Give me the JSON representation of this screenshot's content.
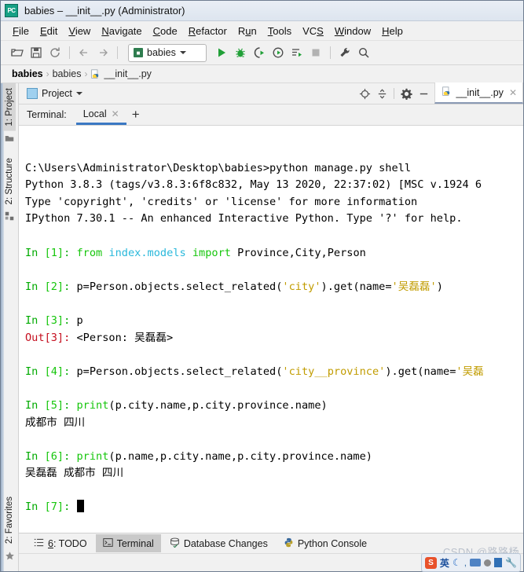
{
  "window": {
    "app_icon": "pycharm-icon",
    "title": "babies – __init__.py (Administrator)"
  },
  "menubar": {
    "items": [
      {
        "label": "File",
        "mnemonic": "F"
      },
      {
        "label": "Edit",
        "mnemonic": "E"
      },
      {
        "label": "View",
        "mnemonic": "V"
      },
      {
        "label": "Navigate",
        "mnemonic": "N"
      },
      {
        "label": "Code",
        "mnemonic": "C"
      },
      {
        "label": "Refactor",
        "mnemonic": "R"
      },
      {
        "label": "Run",
        "mnemonic": "u"
      },
      {
        "label": "Tools",
        "mnemonic": "T"
      },
      {
        "label": "VCS",
        "mnemonic": "S"
      },
      {
        "label": "Window",
        "mnemonic": "W"
      },
      {
        "label": "Help",
        "mnemonic": "H"
      }
    ]
  },
  "toolbar": {
    "icons": [
      "open-folder-icon",
      "save-all-icon",
      "sync-refresh-icon",
      "back-arrow-icon",
      "forward-arrow-icon"
    ],
    "run_config": {
      "name": "babies",
      "icon": "run-config-icon",
      "dropdown": "chevron-down-icon"
    },
    "run_icons": [
      "run-icon",
      "debug-icon",
      "run-with-coverage-icon",
      "profile-icon",
      "run-todo-icon",
      "stop-icon"
    ],
    "right_icons": [
      "settings-wrench-icon",
      "search-icon"
    ]
  },
  "breadcrumb": {
    "items": [
      "babies",
      "babies",
      "__init__.py"
    ],
    "separator": "›",
    "file_icon": "python-file-icon"
  },
  "leftbar": {
    "tabs": [
      {
        "label": "1: Project",
        "icon": "project-folder-icon",
        "selected": true
      },
      {
        "label": "2: Structure",
        "icon": "structure-icon",
        "selected": false
      },
      {
        "label": "2: Favorites",
        "icon": "star-icon",
        "selected": false
      }
    ]
  },
  "toolwindow": {
    "title": "Project",
    "title_icon": "project-window-icon",
    "dropdown": "chevron-down-icon",
    "actions": [
      "locate-target-icon",
      "collapse-all-icon",
      "settings-gear-icon",
      "hide-window-icon"
    ],
    "editor_tab": {
      "label": "__init__.py",
      "icon": "python-file-icon",
      "close": "close-icon"
    }
  },
  "terminal_tabs": {
    "label": "Terminal:",
    "tabs": [
      {
        "label": "Local",
        "close": "close-icon",
        "selected": true
      }
    ],
    "add_button": "+"
  },
  "terminal": {
    "lines": [
      {
        "type": "blank"
      },
      {
        "segments": [
          {
            "text": "C:\\Users\\Administrator\\Desktop\\babies>python manage.py shell",
            "color": "default"
          }
        ]
      },
      {
        "segments": [
          {
            "text": "Python 3.8.3 (tags/v3.8.3:6f8c832, May 13 2020, 22:37:02) [MSC v.1924 6",
            "color": "default"
          }
        ]
      },
      {
        "segments": [
          {
            "text": "Type 'copyright', 'credits' or 'license' for more information",
            "color": "default"
          }
        ]
      },
      {
        "segments": [
          {
            "text": "IPython 7.30.1 -- An enhanced Interactive Python. Type '?' for help.",
            "color": "default"
          }
        ]
      },
      {
        "type": "blank"
      },
      {
        "segments": [
          {
            "text": "In ",
            "color": "green"
          },
          {
            "text": "[1]",
            "color": "brightgreen"
          },
          {
            "text": ": ",
            "color": "green"
          },
          {
            "text": "from ",
            "color": "brightgreen"
          },
          {
            "text": "index.models ",
            "color": "cyan"
          },
          {
            "text": "import ",
            "color": "brightgreen"
          },
          {
            "text": "Province,City,Person",
            "color": "default"
          }
        ]
      },
      {
        "type": "blank"
      },
      {
        "segments": [
          {
            "text": "In ",
            "color": "green"
          },
          {
            "text": "[2]",
            "color": "brightgreen"
          },
          {
            "text": ": ",
            "color": "green"
          },
          {
            "text": "p=Person.objects.select_related(",
            "color": "default"
          },
          {
            "text": "'city'",
            "color": "yellow"
          },
          {
            "text": ").get(name=",
            "color": "default"
          },
          {
            "text": "'吴磊磊'",
            "color": "yellow"
          },
          {
            "text": ")",
            "color": "default"
          }
        ]
      },
      {
        "type": "blank"
      },
      {
        "segments": [
          {
            "text": "In ",
            "color": "green"
          },
          {
            "text": "[3]",
            "color": "brightgreen"
          },
          {
            "text": ": ",
            "color": "green"
          },
          {
            "text": "p",
            "color": "default"
          }
        ]
      },
      {
        "segments": [
          {
            "text": "Out",
            "color": "red"
          },
          {
            "text": "[3]",
            "color": "red"
          },
          {
            "text": ": ",
            "color": "red"
          },
          {
            "text": "<Person: 吴磊磊>",
            "color": "default"
          }
        ]
      },
      {
        "type": "blank"
      },
      {
        "segments": [
          {
            "text": "In ",
            "color": "green"
          },
          {
            "text": "[4]",
            "color": "brightgreen"
          },
          {
            "text": ": ",
            "color": "green"
          },
          {
            "text": "p=Person.objects.select_related(",
            "color": "default"
          },
          {
            "text": "'city__province'",
            "color": "yellow"
          },
          {
            "text": ").get(name=",
            "color": "default"
          },
          {
            "text": "'吴磊",
            "color": "yellow"
          }
        ]
      },
      {
        "type": "blank"
      },
      {
        "segments": [
          {
            "text": "In ",
            "color": "green"
          },
          {
            "text": "[5]",
            "color": "brightgreen"
          },
          {
            "text": ": ",
            "color": "green"
          },
          {
            "text": "print",
            "color": "brightgreen"
          },
          {
            "text": "(p.city.name,p.city.province.name)",
            "color": "default"
          }
        ]
      },
      {
        "segments": [
          {
            "text": "成都市 四川",
            "color": "default"
          }
        ]
      },
      {
        "type": "blank"
      },
      {
        "segments": [
          {
            "text": "In ",
            "color": "green"
          },
          {
            "text": "[6]",
            "color": "brightgreen"
          },
          {
            "text": ": ",
            "color": "green"
          },
          {
            "text": "print",
            "color": "brightgreen"
          },
          {
            "text": "(p.name,p.city.name,p.city.province.name)",
            "color": "default"
          }
        ]
      },
      {
        "segments": [
          {
            "text": "吴磊磊 成都市 四川",
            "color": "default"
          }
        ]
      },
      {
        "type": "blank"
      },
      {
        "segments": [
          {
            "text": "In ",
            "color": "green"
          },
          {
            "text": "[7]",
            "color": "brightgreen"
          },
          {
            "text": ": ",
            "color": "green"
          }
        ],
        "cursor": true
      }
    ]
  },
  "bottom_tabs": [
    {
      "label": "6: TODO",
      "icon": "todo-list-icon",
      "selected": false,
      "mnemonic": "6"
    },
    {
      "label": "Terminal",
      "icon": "terminal-icon",
      "selected": true
    },
    {
      "label": "Database Changes",
      "icon": "database-icon",
      "selected": false
    },
    {
      "label": "Python Console",
      "icon": "python-console-icon",
      "selected": false
    }
  ],
  "watermark": {
    "text": "CSDN @路路杨"
  },
  "ime": {
    "logo": "S",
    "lang": "英",
    "items": [
      "moon-icon",
      "comma-icon",
      "keyboard-icon",
      "mic-icon",
      "box-icon",
      "wrench-icon"
    ]
  },
  "colors": {
    "accent_blue": "#3b78c3",
    "terminal_green": "#00aa00",
    "terminal_bright_green": "#16c60c",
    "terminal_cyan": "#29b8db",
    "terminal_red": "#c50f1f",
    "terminal_yellow": "#c19c00",
    "chrome_bg": "#f1f1f1"
  }
}
